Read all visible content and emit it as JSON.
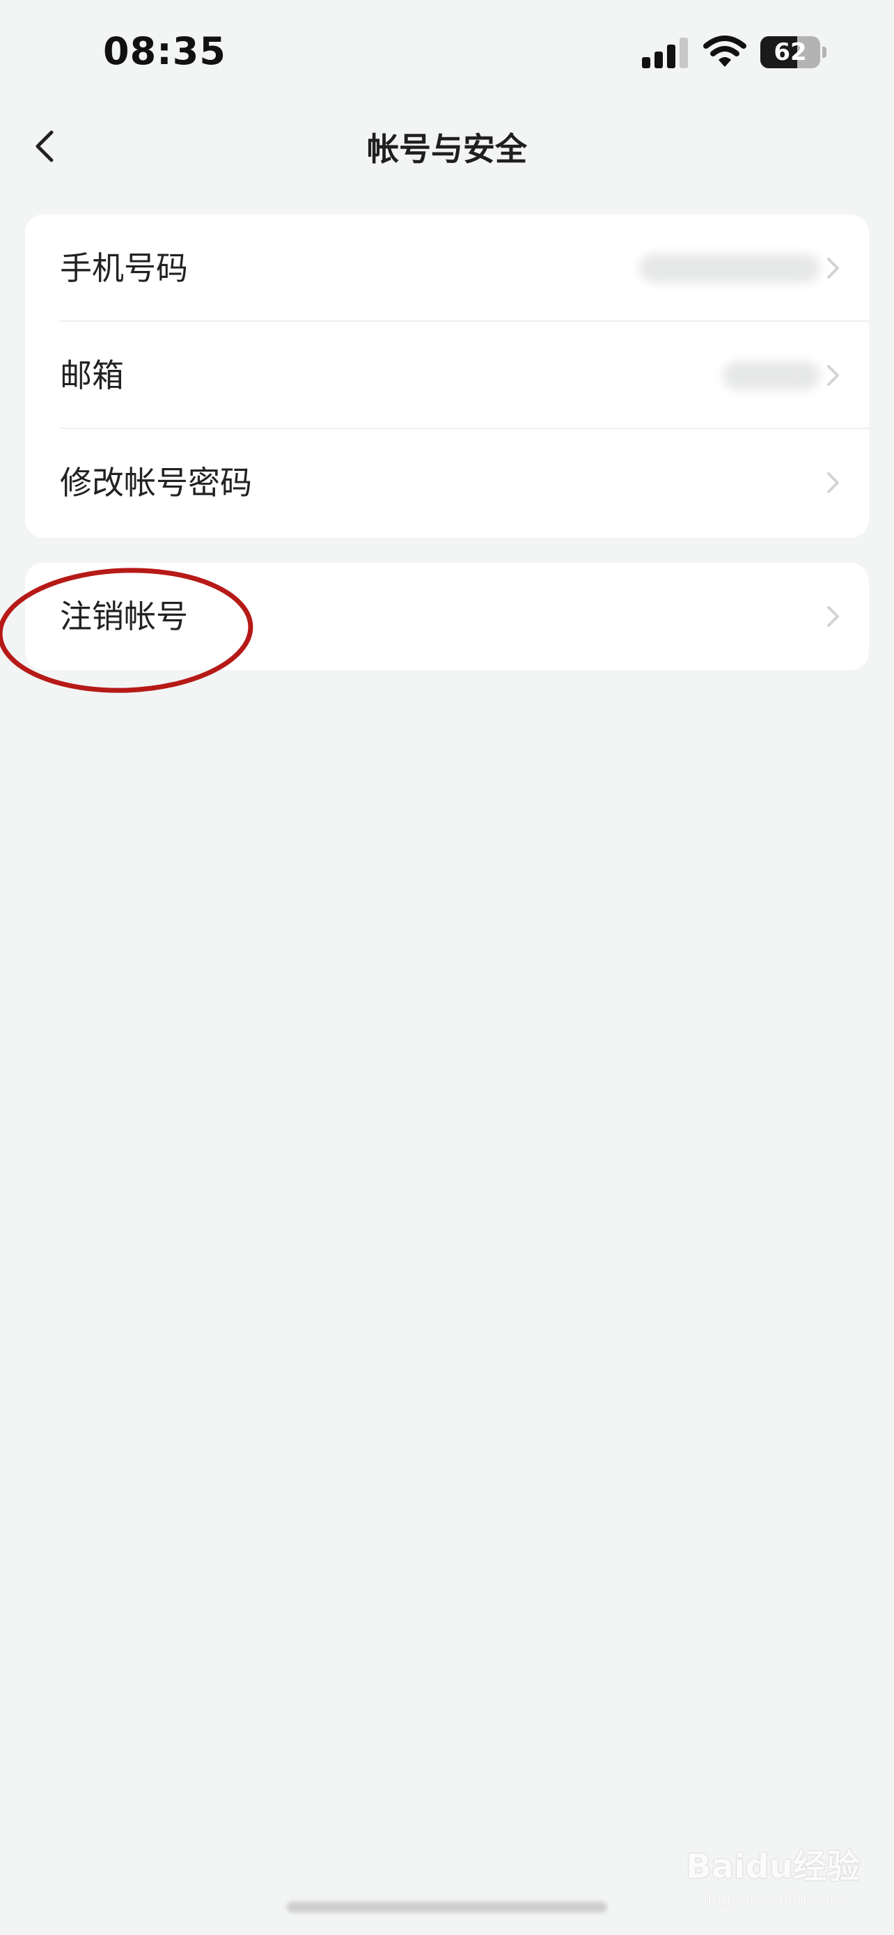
{
  "status_bar": {
    "time": "08:35",
    "battery_level": "62",
    "battery_fraction": 0.62,
    "icons": [
      "signal-icon",
      "wifi-icon",
      "battery-icon"
    ]
  },
  "nav": {
    "title": "帐号与安全",
    "back_icon": "chevron-left-icon"
  },
  "settings": {
    "account_group": [
      {
        "label": "手机号码"
      },
      {
        "label": "邮箱"
      },
      {
        "label": "修改帐号密码"
      }
    ],
    "danger_group": [
      {
        "label": "注销帐号"
      }
    ]
  },
  "annotation": {
    "type": "ellipse",
    "color": "#b61a17"
  },
  "watermark": {
    "text": "Baidu经验",
    "sub": "jingyan.baidu.com"
  },
  "colors": {
    "background": "#f3f4f4",
    "card": "#ffffff",
    "highlight": "#b61a17"
  }
}
